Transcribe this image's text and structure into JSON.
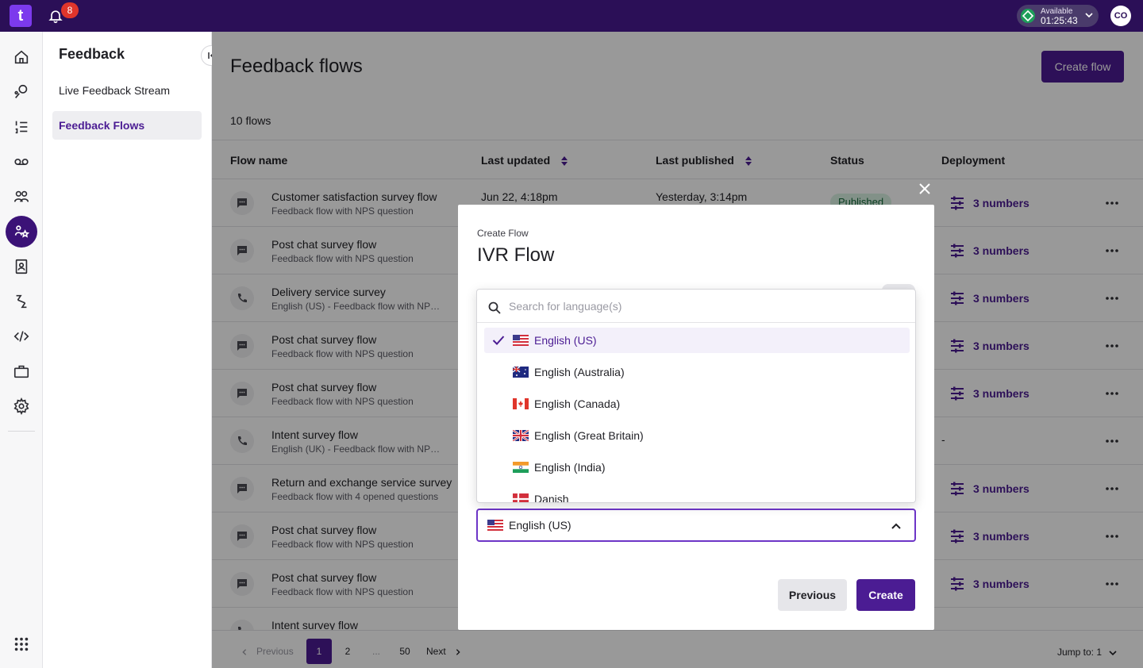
{
  "topbar": {
    "logo_text": "t",
    "notification_count": "8",
    "availability_label": "Available",
    "availability_time": "01:25:43",
    "avatar_initials": "CO"
  },
  "subnav": {
    "title": "Feedback",
    "items": [
      {
        "label": "Live Feedback Stream"
      },
      {
        "label": "Feedback Flows"
      }
    ]
  },
  "main": {
    "title": "Feedback flows",
    "create_button": "Create flow",
    "flows_count": "10 flows",
    "columns": [
      "Flow name",
      "Last updated",
      "Last published",
      "Status",
      "Deployment"
    ],
    "rows": [
      {
        "icon": "chat-icon",
        "name": "Customer satisfaction survey flow",
        "sub": "Feedback flow with NPS question",
        "updated": "Jun 22, 4:18pm",
        "published": "Yesterday, 3:14pm",
        "status": "Published",
        "deploy": "3 numbers"
      },
      {
        "icon": "chat-icon",
        "name": "Post chat survey flow",
        "sub": "Feedback flow with NPS question",
        "updated": "",
        "published": "",
        "status": "",
        "deploy": "3 numbers"
      },
      {
        "icon": "phone-icon",
        "name": "Delivery service survey",
        "sub": "English (US) - Feedback flow with NPS...",
        "updated": "",
        "published": "",
        "status": "",
        "deploy": "3 numbers"
      },
      {
        "icon": "chat-icon",
        "name": "Post chat survey flow",
        "sub": "Feedback flow with NPS question",
        "updated": "",
        "published": "",
        "status": "",
        "deploy": "3 numbers"
      },
      {
        "icon": "chat-icon",
        "name": "Post chat survey flow",
        "sub": "Feedback flow with NPS question",
        "updated": "",
        "published": "",
        "status": "",
        "deploy": "3 numbers"
      },
      {
        "icon": "phone-icon",
        "name": "Intent survey flow",
        "sub": "English (UK) - Feedback flow with NPS...",
        "updated": "",
        "published": "",
        "status": "",
        "deploy": "-"
      },
      {
        "icon": "chat-icon",
        "name": "Return and exchange service survey",
        "sub": "Feedback flow with 4 opened questions",
        "updated": "",
        "published": "",
        "status": "",
        "deploy": "3 numbers"
      },
      {
        "icon": "chat-icon",
        "name": "Post chat survey flow",
        "sub": "Feedback flow with NPS question",
        "updated": "",
        "published": "",
        "status": "",
        "deploy": "3 numbers"
      },
      {
        "icon": "chat-icon",
        "name": "Post chat survey flow",
        "sub": "Feedback flow with NPS question",
        "updated": "",
        "published": "",
        "status": "",
        "deploy": "3 numbers"
      },
      {
        "icon": "phone-icon",
        "name": "Intent survey flow",
        "sub": "",
        "updated": "",
        "published": "",
        "status": "",
        "deploy": ""
      }
    ],
    "pager": {
      "previous": "Previous",
      "pages": [
        "1",
        "2",
        "...",
        "50"
      ],
      "next": "Next",
      "jump_label": "Jump to:",
      "jump_value": "1"
    }
  },
  "modal": {
    "eyebrow": "Create Flow",
    "title": "IVR Flow",
    "selected_language": "English (US)",
    "previous_button": "Previous",
    "create_button": "Create"
  },
  "dropdown": {
    "search_placeholder": "Search for language(s)",
    "options": [
      {
        "label": "English (US)",
        "flag": "us"
      },
      {
        "label": "English (Australia)",
        "flag": "au"
      },
      {
        "label": "English (Canada)",
        "flag": "ca"
      },
      {
        "label": "English (Great Britain)",
        "flag": "gb"
      },
      {
        "label": "English (India)",
        "flag": "in"
      },
      {
        "label": "Danish",
        "flag": "dk"
      }
    ]
  },
  "colors": {
    "topbar": "#2b0f57",
    "accent": "#4b1c93",
    "badge": "#e0352b",
    "available": "#1e9e5a"
  }
}
